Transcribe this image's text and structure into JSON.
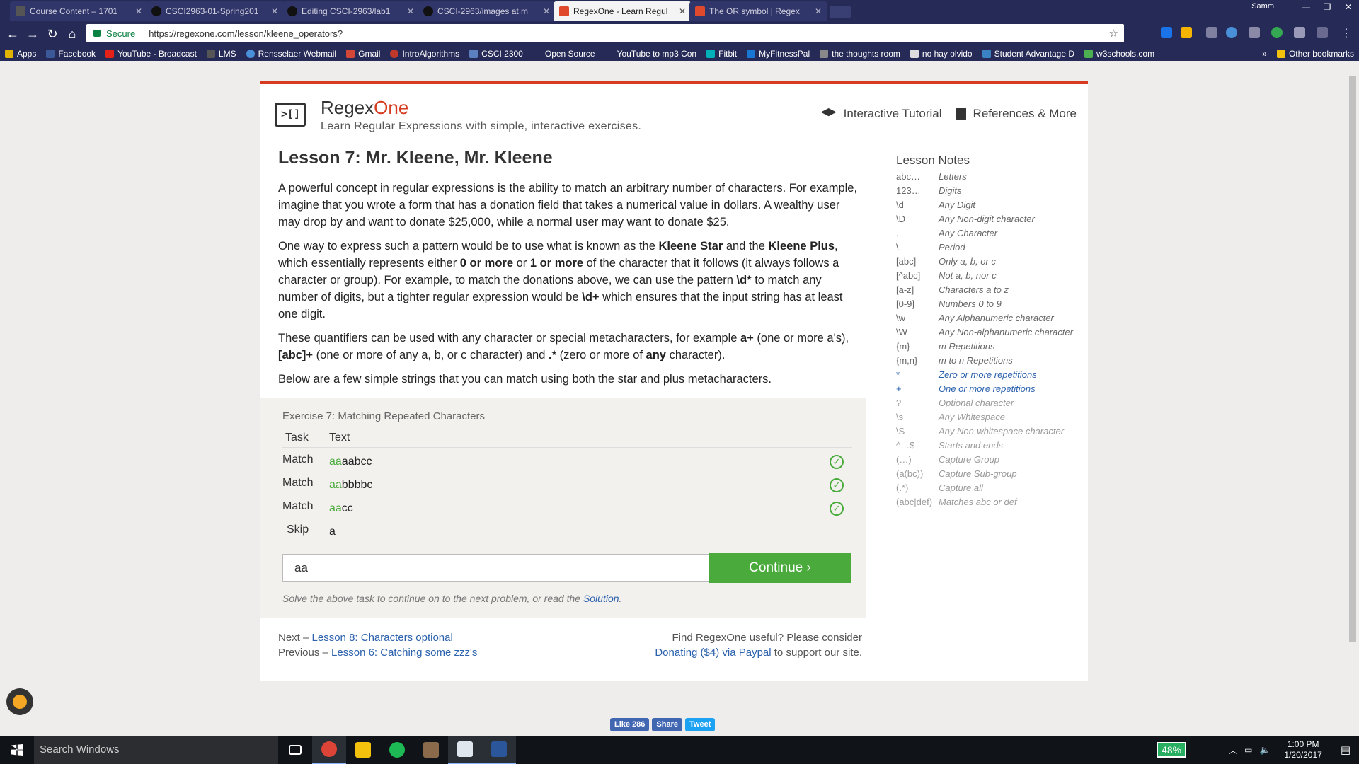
{
  "browser": {
    "tabs": [
      {
        "title": "Course Content – 1701"
      },
      {
        "title": "CSCI2963-01-Spring201"
      },
      {
        "title": "Editing CSCI-2963/lab1"
      },
      {
        "title": "CSCI-2963/images at m"
      },
      {
        "title": "RegexOne - Learn Regul"
      },
      {
        "title": "The OR symbol | Regex"
      }
    ],
    "profile": "Samm",
    "secure_label": "Secure",
    "url": "https://regexone.com/lesson/kleene_operators?",
    "bookmarks": [
      "Apps",
      "Facebook",
      "YouTube - Broadcast",
      "LMS",
      "Rensselaer Webmail",
      "Gmail",
      "IntroAlgorithms",
      "CSCI 2300",
      "Open Source",
      "YouTube to mp3 Con",
      "Fitbit",
      "MyFitnessPal",
      "the thoughts room",
      "no hay olvido",
      "Student Advantage D",
      "w3schools.com"
    ],
    "bookmarks_more": "»",
    "other_bookmarks": "Other bookmarks"
  },
  "site": {
    "brand_a": "Regex",
    "brand_b": "One",
    "tagline": "Learn Regular Expressions with simple, interactive exercises.",
    "nav": {
      "tutorial": "Interactive Tutorial",
      "references": "References & More"
    }
  },
  "lesson": {
    "title": "Lesson 7: Mr. Kleene, Mr. Kleene",
    "p1": "A powerful concept in regular expressions is the ability to match an arbitrary number of characters. For example, imagine that you wrote a form that has a donation field that takes a numerical value in dollars. A wealthy user may drop by and want to donate $25,000, while a normal user may want to donate $25.",
    "p2": {
      "a": "One way to express such a pattern would be to use what is known as the ",
      "b": "Kleene Star",
      "c": " and the ",
      "d": "Kleene Plus",
      "e": ", which essentially represents either ",
      "f": "0 or more",
      "g": " or ",
      "h": "1 or more",
      "i": " of the character that it follows (it always follows a character or group). For example, to match the donations above, we can use the pattern ",
      "j": "\\d*",
      "k": " to match any number of digits, but a tighter regular expression would be ",
      "l": "\\d+",
      "m": " which ensures that the input string has at least one digit."
    },
    "p3": {
      "a": "These quantifiers can be used with any character or special metacharacters, for example ",
      "b": "a+",
      "c": " (one or more a's), ",
      "d": "[abc]+",
      "e": " (one or more of any a, b, or c character) and ",
      "f": ".*",
      "g": " (zero or more of ",
      "h": "any",
      "i": " character)."
    },
    "p4": "Below are a few simple strings that you can match using both the star and plus metacharacters."
  },
  "notes": {
    "title": "Lesson Notes",
    "rows": [
      {
        "k": "abc…",
        "v": "Letters"
      },
      {
        "k": "123…",
        "v": "Digits"
      },
      {
        "k": "\\d",
        "v": "Any Digit"
      },
      {
        "k": "\\D",
        "v": "Any Non-digit character"
      },
      {
        "k": ".",
        "v": "Any Character"
      },
      {
        "k": "\\.",
        "v": "Period"
      },
      {
        "k": "[abc]",
        "v": "Only a, b, or c"
      },
      {
        "k": "[^abc]",
        "v": "Not a, b, nor c"
      },
      {
        "k": "[a-z]",
        "v": "Characters a to z"
      },
      {
        "k": "[0-9]",
        "v": "Numbers 0 to 9"
      },
      {
        "k": "\\w",
        "v": "Any Alphanumeric character"
      },
      {
        "k": "\\W",
        "v": "Any Non-alphanumeric character"
      },
      {
        "k": "{m}",
        "v": "m Repetitions"
      },
      {
        "k": "{m,n}",
        "v": "m to n Repetitions"
      },
      {
        "k": "*",
        "v": "Zero or more repetitions"
      },
      {
        "k": "+",
        "v": "One or more repetitions"
      },
      {
        "k": "?",
        "v": "Optional character"
      },
      {
        "k": "\\s",
        "v": "Any Whitespace"
      },
      {
        "k": "\\S",
        "v": "Any Non-whitespace character"
      },
      {
        "k": "^…$",
        "v": "Starts and ends"
      },
      {
        "k": "(…)",
        "v": "Capture Group"
      },
      {
        "k": "(a(bc))",
        "v": "Capture Sub-group"
      },
      {
        "k": "(.*)",
        "v": "Capture all"
      },
      {
        "k": "(abc|def)",
        "v": "Matches abc or def"
      }
    ]
  },
  "exercise": {
    "title": "Exercise 7: Matching Repeated Characters",
    "col_task": "Task",
    "col_text": "Text",
    "rows": [
      {
        "task": "Match",
        "matched": "aa",
        "rest": "aabcc",
        "check": "✓"
      },
      {
        "task": "Match",
        "matched": "aa",
        "rest": "bbbbc",
        "check": "✓"
      },
      {
        "task": "Match",
        "matched": "aa",
        "rest": "cc",
        "check": "✓"
      },
      {
        "task": "Skip",
        "matched": "",
        "rest": "a",
        "check": ""
      }
    ],
    "input_value": "aa",
    "continue_label": "Continue ›",
    "hint_a": "Solve the above task to continue on to the next problem, or read the ",
    "hint_link": "Solution",
    "hint_b": "."
  },
  "footer": {
    "next_prefix": "Next – ",
    "next_link": "Lesson 8: Characters optional",
    "prev_prefix": "Previous – ",
    "prev_link": "Lesson 6: Catching some zzz's",
    "donate_line": "Find RegexOne useful? Please consider",
    "donate_link": "Donating ($4) via Paypal",
    "donate_suffix": " to support our site."
  },
  "social": {
    "like": "Like 286",
    "share": "Share",
    "tweet": "Tweet"
  },
  "taskbar": {
    "search": "Search Windows",
    "battery": "48%",
    "time": "1:00 PM",
    "date": "1/20/2017"
  }
}
